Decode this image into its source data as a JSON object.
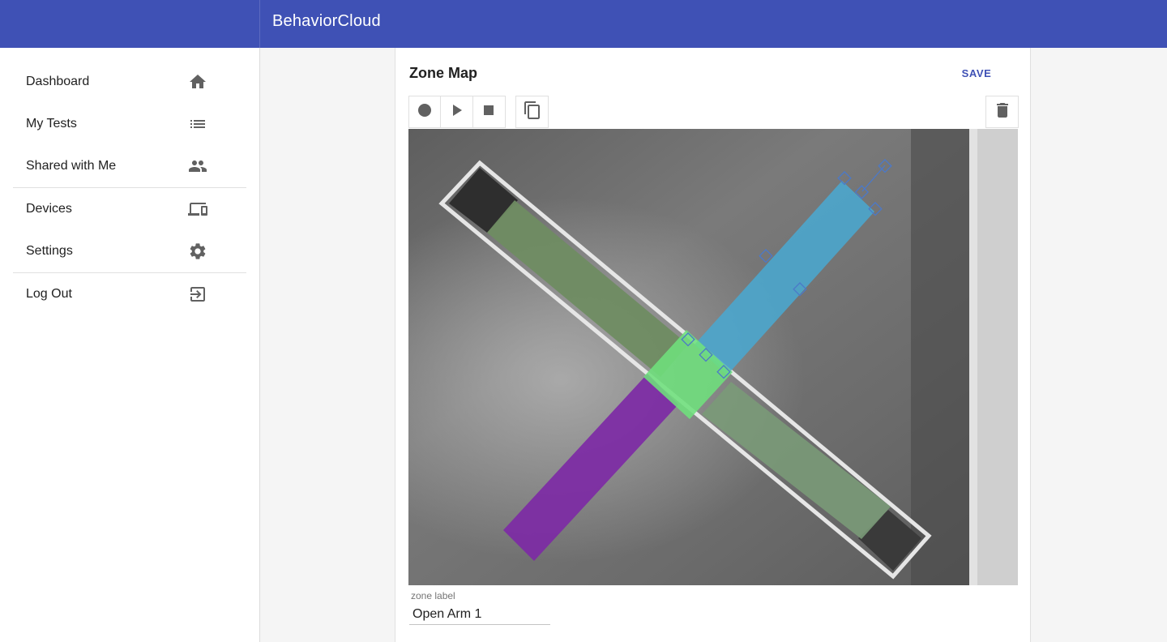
{
  "app": {
    "title": "BehaviorCloud"
  },
  "sidebar": {
    "items": [
      {
        "label": "Dashboard",
        "icon": "home-icon"
      },
      {
        "label": "My Tests",
        "icon": "list-icon"
      },
      {
        "label": "Shared with Me",
        "icon": "people-icon"
      },
      {
        "label": "Devices",
        "icon": "devices-icon"
      },
      {
        "label": "Settings",
        "icon": "gear-icon"
      },
      {
        "label": "Log Out",
        "icon": "exit-icon"
      }
    ]
  },
  "zone_map": {
    "title": "Zone Map",
    "save_label": "SAVE",
    "tools": [
      "record-icon",
      "play-icon",
      "stop-icon",
      "copy-icon",
      "delete-icon"
    ],
    "zone_label_caption": "zone label",
    "zone_label_value": "Open Arm 1"
  },
  "colors": {
    "accent": "#3f51b5",
    "zone_blue": "#4ba6cd",
    "zone_green": "#6ee07c",
    "zone_purple": "#7d2aa5",
    "zone_olive": "#6f8c62"
  }
}
